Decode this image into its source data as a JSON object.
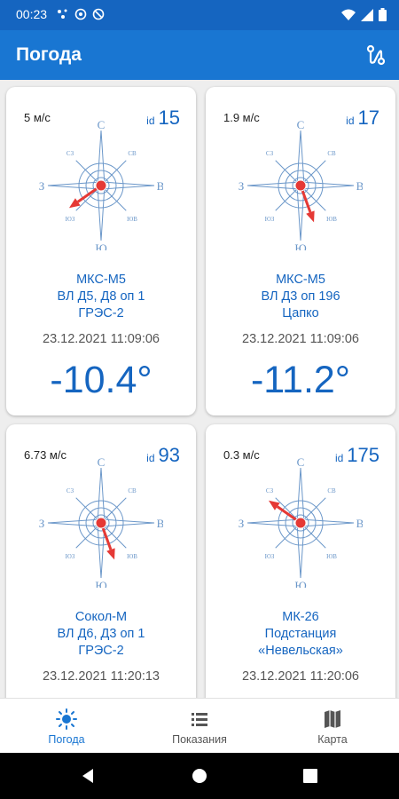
{
  "status_bar": {
    "time": "00:23",
    "icons": [
      "dots-icon",
      "at-icon",
      "no-disturb-icon",
      "wifi-icon",
      "signal-icon",
      "battery-icon"
    ]
  },
  "app_bar": {
    "title": "Погода",
    "action_icon": "route-icon"
  },
  "colors": {
    "primary": "#1976d2",
    "status_bar": "#1565c0",
    "accent_text": "#1565c0",
    "arrow": "#e53935",
    "compass": "#6b97c9"
  },
  "compass_labels": {
    "north": "С",
    "south": "Ю",
    "west": "З",
    "east": "В",
    "northeast": "СВ",
    "northwest": "СЗ",
    "southeast": "ЮВ",
    "southwest": "ЮЗ"
  },
  "stations": [
    {
      "wind": "5 м/с",
      "id_label": "id",
      "id": "15",
      "name_lines": [
        "МКС-М5",
        "ВЛ Д5, Д8 оп 1",
        "ГРЭС-2"
      ],
      "date": "23.12.2021 11:09:06",
      "temperature": "-10.4°",
      "wind_arrow_deg": 235
    },
    {
      "wind": "1.9 м/с",
      "id_label": "id",
      "id": "17",
      "name_lines": [
        "МКС-М5",
        "ВЛ Д3 оп 196",
        "Цапко"
      ],
      "date": "23.12.2021 11:09:06",
      "temperature": "-11.2°",
      "wind_arrow_deg": 160
    },
    {
      "wind": "6.73 м/с",
      "id_label": "id",
      "id": "93",
      "name_lines": [
        "Сокол-М",
        "ВЛ Д6, Д3 оп 1",
        "ГРЭС-2"
      ],
      "date": "23.12.2021 11:20:13",
      "temperature": "",
      "wind_arrow_deg": 160
    },
    {
      "wind": "0.3 м/с",
      "id_label": "id",
      "id": "175",
      "name_lines": [
        "МК-26",
        "Подстанция",
        "«Невельская»"
      ],
      "date": "23.12.2021 11:20:06",
      "temperature": "",
      "wind_arrow_deg": 305
    }
  ],
  "bottom_nav": [
    {
      "label": "Погода",
      "icon": "sun-icon",
      "active": true
    },
    {
      "label": "Показания",
      "icon": "list-icon",
      "active": false
    },
    {
      "label": "Карта",
      "icon": "map-icon",
      "active": false
    }
  ],
  "system_nav": [
    "back-icon",
    "home-icon",
    "recents-icon"
  ]
}
